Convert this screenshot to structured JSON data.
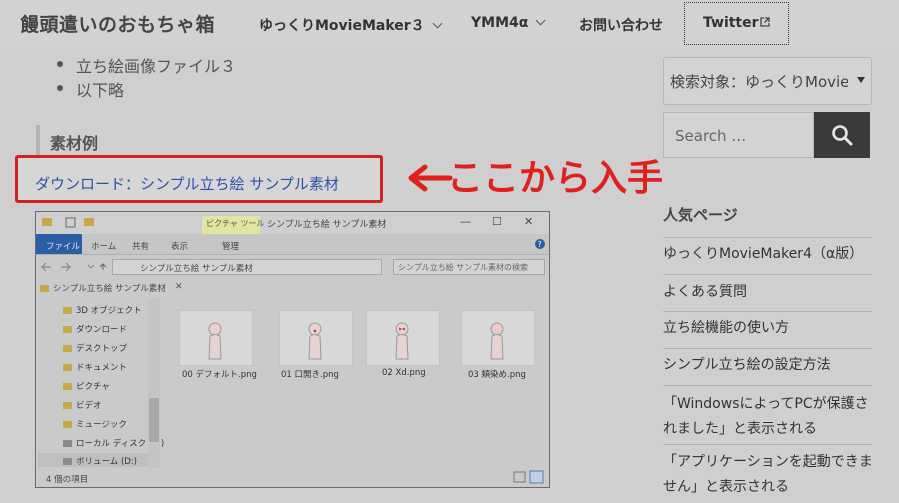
{
  "header": {
    "site_title": "饅頭遣いのおもちゃ箱",
    "nav": [
      {
        "label": "ゆっくりMovieMaker３"
      },
      {
        "label": "YMM4α"
      },
      {
        "label": "お問い合わせ"
      },
      {
        "label": "Twitter"
      }
    ]
  },
  "article": {
    "bullets": [
      "立ち絵画像ファイル３",
      "以下略"
    ],
    "section_heading": "素材例",
    "download_link": "ダウンロード：シンプル立ち絵 サンプル素材",
    "annotation": "ここから入手",
    "annotation_color": "#e0201c"
  },
  "explorer": {
    "window_title": "シンプル立ち絵 サンプル素材",
    "picture_tools": "ピクチャ ツール",
    "ribbon_tabs": [
      "ファイル",
      "ホーム",
      "共有",
      "表示",
      "管理"
    ],
    "address": "シンプル立ち絵 サンプル素材",
    "search_placeholder": "シンプル立ち絵 サンプル素材の検索",
    "nav_tab": "シンプル立ち絵 サンプル素材",
    "tree": [
      "3D オブジェクト",
      "ダウンロード",
      "デスクトップ",
      "ドキュメント",
      "ピクチャ",
      "ビデオ",
      "ミュージック",
      "ローカル ディスク (C:)",
      "ボリューム (D:)"
    ],
    "files": [
      "00 デフォルト.png",
      "01 口開き.png",
      "02 Xd.png",
      "03 頬染め.png"
    ],
    "status": "4 個の項目"
  },
  "sidebar": {
    "search_target": "検索対象：ゆっくりMovieMaker",
    "search_placeholder": "Search …",
    "popular_title": "人気ページ",
    "popular": [
      "ゆっくりMovieMaker4（α版）",
      "よくある質問",
      "立ち絵機能の使い方",
      "シンプル立ち絵の設定方法",
      "「WindowsによってPCが保護されました」と表示される",
      "「アプリケーションを起動できません」と表示される"
    ]
  }
}
